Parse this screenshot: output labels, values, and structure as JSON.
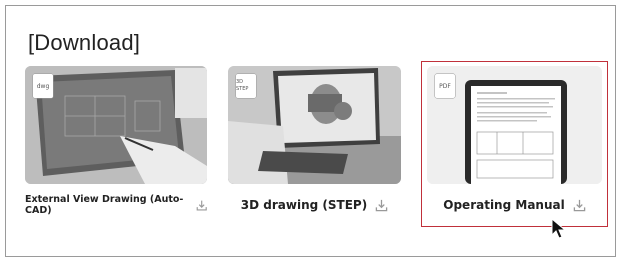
{
  "section": {
    "title": "[Download]"
  },
  "cards": [
    {
      "label": "External View Drawing (Auto-CAD)",
      "badge": "dwg",
      "icon": "download-icon"
    },
    {
      "label": "3D drawing (STEP)",
      "badge": "3D STEP",
      "icon": "download-icon"
    },
    {
      "label": "Operating Manual",
      "badge": "PDF",
      "icon": "download-icon"
    }
  ],
  "colors": {
    "highlight": "#c0303a",
    "text": "#222222",
    "icon": "#999999"
  }
}
